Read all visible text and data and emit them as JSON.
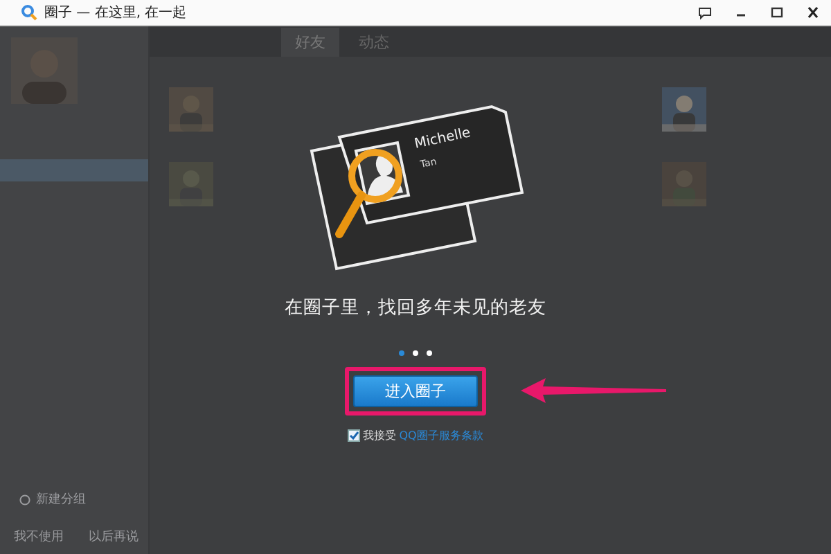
{
  "window": {
    "title": "圈子 — 在这里, 在一起"
  },
  "tabs": [
    {
      "label": "好友",
      "selected": true
    },
    {
      "label": "动态",
      "selected": false
    }
  ],
  "sidebar": {
    "new_group": "新建分组",
    "footer_links": [
      "我不使用",
      "以后再说"
    ]
  },
  "intro": {
    "card_name": "Michelle",
    "card_subname": "Tan",
    "tagline": "在圈子里，找回多年未见的老友",
    "pages": [
      {
        "selected": true
      },
      {
        "selected": false
      },
      {
        "selected": false
      }
    ],
    "button": "进入圈子",
    "agreement": {
      "checked": true,
      "label": "我接受",
      "link": "QQ圈子服务条款"
    }
  }
}
